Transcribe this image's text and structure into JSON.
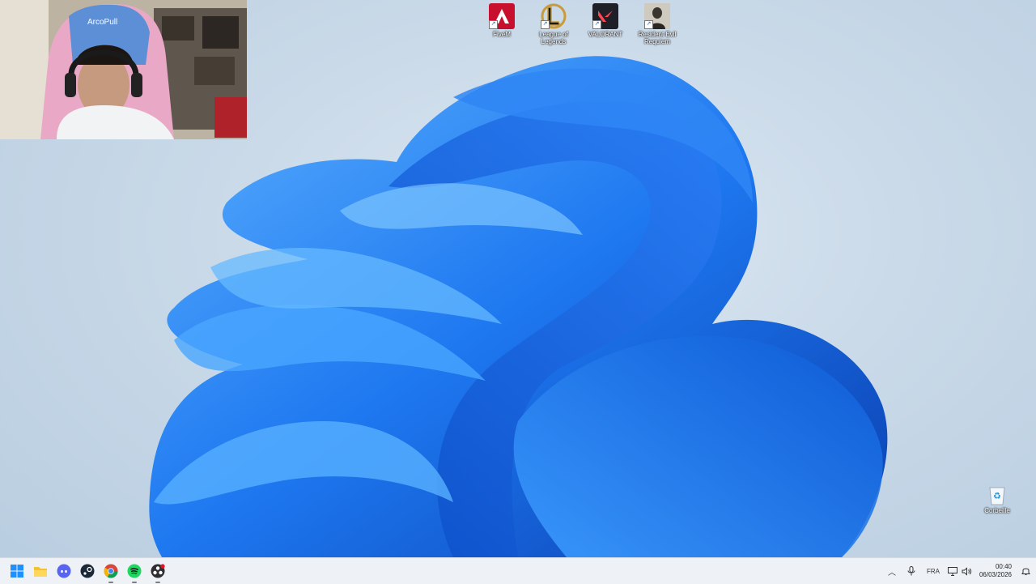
{
  "desktop": {
    "icons": [
      {
        "label": "FiveM",
        "icon": "fivem-icon",
        "color": "#c8102e"
      },
      {
        "label": "League of Legends",
        "icon": "league-of-legends-icon",
        "color": "#c89b3c"
      },
      {
        "label": "VALORANT",
        "icon": "valorant-icon",
        "color": "#ff4655"
      },
      {
        "label": "Resident Evil Requiem",
        "icon": "resident-evil-icon",
        "color": "#3a3a3a"
      }
    ],
    "recycle_bin": {
      "label": "Corbeille",
      "icon": "recycle-bin-icon"
    }
  },
  "webcam": {
    "chair_text": "ArcoPull"
  },
  "taskbar": {
    "apps": [
      {
        "name": "start",
        "icon": "windows-start-icon"
      },
      {
        "name": "file-explorer",
        "icon": "folder-icon"
      },
      {
        "name": "discord",
        "icon": "discord-icon"
      },
      {
        "name": "steam",
        "icon": "steam-icon"
      },
      {
        "name": "chrome",
        "icon": "chrome-icon"
      },
      {
        "name": "spotify",
        "icon": "spotify-icon"
      },
      {
        "name": "obs",
        "icon": "obs-icon"
      }
    ],
    "tray": {
      "language": "FRA",
      "time": "00:40",
      "date": "06/03/2026"
    }
  },
  "colors": {
    "accent": "#1e6fd9",
    "taskbar_bg": "#eef2f7"
  }
}
